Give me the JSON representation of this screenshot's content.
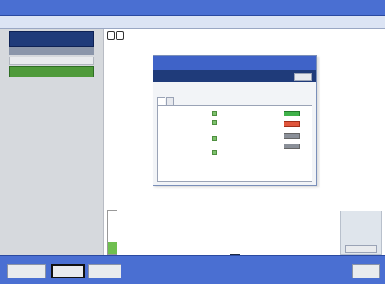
{
  "window": {
    "title": ""
  },
  "menubar": {
    "breadcrumb": "",
    "clock_line1": "",
    "clock_line2": ""
  },
  "sidebar": {
    "header_line1": "",
    "header_line2": "",
    "field_value": "",
    "status_label": "",
    "status_color": "#4f9a3a",
    "kv": [
      {
        "label": "",
        "value": ""
      },
      {
        "label": "",
        "value": ""
      }
    ],
    "footer": ""
  },
  "content": {
    "nav_back": "",
    "nav_forward": "",
    "caption": ""
  },
  "dialog": {
    "title": "",
    "subbar": "",
    "close_label": "",
    "description": "",
    "tabs": [
      {
        "label": ""
      },
      {
        "label": ""
      }
    ],
    "left_rows": [
      {
        "label": ""
      },
      {
        "label": ""
      },
      {
        "label": ""
      },
      {
        "label": ""
      }
    ],
    "right_rows": [
      {
        "label": "",
        "state": "green"
      },
      {
        "label": "",
        "state": "red"
      },
      {
        "label": "",
        "state": "grey"
      },
      {
        "label": "",
        "state": "grey"
      }
    ]
  },
  "level_bar": {
    "label": "",
    "fraction": 0.3
  },
  "pager": {
    "label": "",
    "page": ""
  },
  "right_panel": {
    "title": "",
    "value": "",
    "button": ""
  },
  "bottom": {
    "btn1": "",
    "btn2": "",
    "btn3": "",
    "btn4": ""
  }
}
